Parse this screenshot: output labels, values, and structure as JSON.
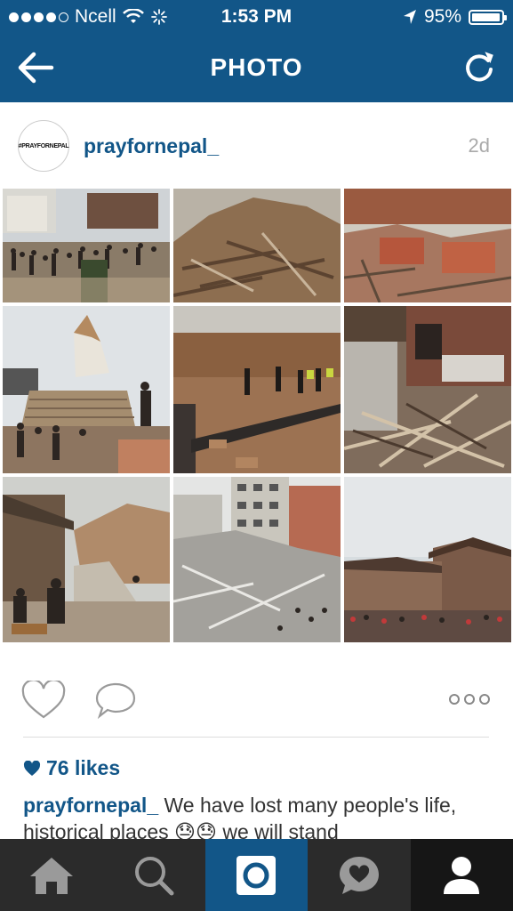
{
  "status": {
    "carrier": "Ncell",
    "time": "1:53 PM",
    "battery": "95%"
  },
  "navbar": {
    "title": "PHOTO",
    "back_icon": "back-arrow-icon",
    "refresh_icon": "refresh-icon"
  },
  "post": {
    "avatar_text": "#PRAYFORNEPAL",
    "username": "prayfornepal_",
    "time_ago": "2d",
    "likes": "76 likes",
    "caption_user": "prayfornepal_",
    "caption_text": " We have lost many people's life, historical places 😓😓 we will stand"
  },
  "colors": {
    "brand": "#125688",
    "tabbar": "#2b2b2b"
  },
  "tabs": [
    "home-icon",
    "search-icon",
    "camera-icon",
    "activity-icon",
    "profile-icon"
  ]
}
